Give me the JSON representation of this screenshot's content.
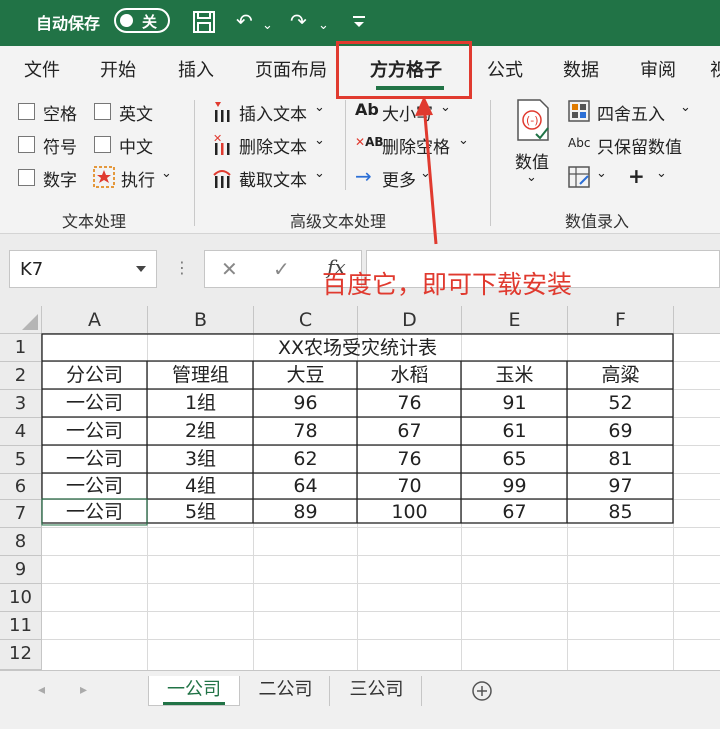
{
  "titlebar": {
    "autosave_label": "自动保存",
    "toggle_state": "关",
    "save_icon": "save-icon",
    "undo_icon": "undo-icon",
    "redo_icon": "redo-icon",
    "customize_icon": "customize-quick-access-icon"
  },
  "menu": {
    "items": [
      "文件",
      "开始",
      "插入",
      "页面布局",
      "方方格子",
      "公式",
      "数据",
      "审阅",
      "视"
    ],
    "active": "方方格子"
  },
  "ribbon": {
    "text_processing": {
      "checkboxes": [
        "空格",
        "符号",
        "数字",
        "英文",
        "中文"
      ],
      "execute": "执行",
      "group_label": "文本处理"
    },
    "advanced_text": {
      "insert": "插入文本",
      "delete": "删除文本",
      "extract": "截取文本",
      "case": "大小写",
      "delete_space": "删除空格",
      "more": "更多",
      "group_label": "高级文本处理"
    },
    "number_entry": {
      "number": "数值",
      "round": "四舍五入",
      "keep_value": "只保留数值",
      "group_label": "数值录入"
    }
  },
  "formula_bar": {
    "name_box": "K7",
    "fx": "fx",
    "cancel_symbol": "✕",
    "confirm_symbol": "✓",
    "value": ""
  },
  "annotation": "百度它，即可下载安装",
  "sheet": {
    "columns": [
      "A",
      "B",
      "C",
      "D",
      "E",
      "F"
    ],
    "rows": [
      "1",
      "2",
      "3",
      "4",
      "5",
      "6",
      "7",
      "8",
      "9",
      "10",
      "11",
      "12"
    ],
    "title": "XX农场受灾统计表",
    "headers": [
      "分公司",
      "管理组",
      "大豆",
      "水稻",
      "玉米",
      "高粱"
    ],
    "data": [
      [
        "一公司",
        "1组",
        "96",
        "76",
        "91",
        "52"
      ],
      [
        "一公司",
        "2组",
        "78",
        "67",
        "61",
        "69"
      ],
      [
        "一公司",
        "3组",
        "62",
        "76",
        "65",
        "81"
      ],
      [
        "一公司",
        "4组",
        "64",
        "70",
        "99",
        "97"
      ],
      [
        "一公司",
        "5组",
        "89",
        "100",
        "67",
        "85"
      ]
    ]
  },
  "tabs": {
    "sheets": [
      "一公司",
      "二公司",
      "三公司"
    ],
    "active": "一公司"
  },
  "colors": {
    "accent": "#217346",
    "highlight": "#e03a2f"
  }
}
